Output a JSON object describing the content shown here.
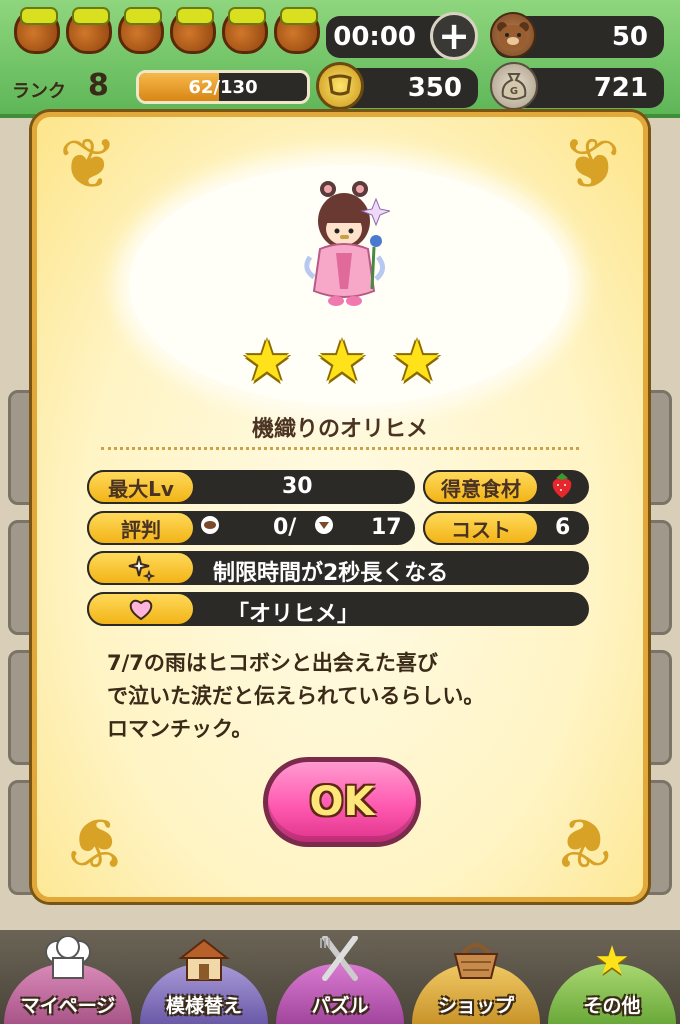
{
  "status": {
    "timer": "00:00",
    "bear_count": "50",
    "rank_label": "ランク",
    "rank": "8",
    "xp_text": "62/130",
    "xp_fraction": 0.477,
    "coins": "350",
    "gold": "721"
  },
  "card": {
    "name": "機織りのオリヒメ",
    "stars": 3,
    "max_lv_label": "最大Lv",
    "max_lv": "30",
    "fav_label": "得意食材",
    "fav_icon": "strawberry-icon",
    "rep_label": "評判",
    "rep_value": "0/",
    "rep_total": "17",
    "cost_label": "コスト",
    "cost": "6",
    "skill": "制限時間が2秒長くなる",
    "series": "「オリヒメ」",
    "description": [
      "7/7の雨はヒコボシと出会えた喜び",
      "で泣いた涙だと伝えられているらしい。",
      "ロマンチック。"
    ],
    "ok_label": "OK"
  },
  "nav": [
    {
      "label": "マイページ",
      "icon": "chef-hat-icon"
    },
    {
      "label": "模様替え",
      "icon": "house-icon"
    },
    {
      "label": "パズル",
      "icon": "fork-knife-icon"
    },
    {
      "label": "ショップ",
      "icon": "basket-icon"
    },
    {
      "label": "その他",
      "icon": "star-icon"
    }
  ],
  "colors": {
    "accent_gold": "#f2b417",
    "ok_pink": "#ff5ab0",
    "header_green": "#5eb657"
  }
}
